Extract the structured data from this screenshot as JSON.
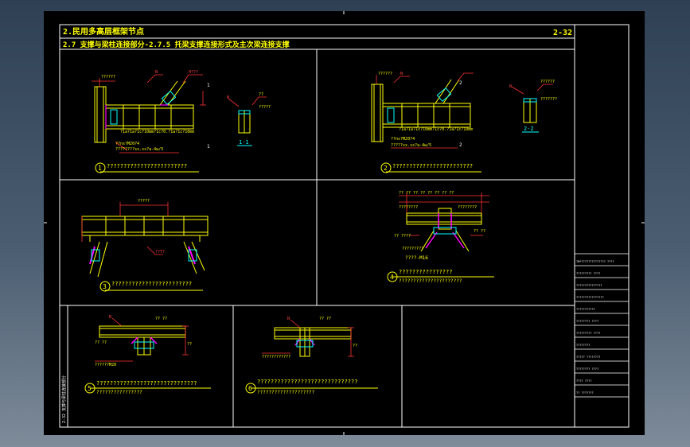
{
  "drawing": {
    "header_title": "2.民用多高层框架节点",
    "sub_title": "2.7 支撑与梁柱连接部分-2.7.5 托梁支撑连接形式及主次梁连接支撑",
    "page_number": "2-32",
    "side_label": "2-32 支撑与梁柱连接部分"
  },
  "details": [
    {
      "number": "1",
      "caption": "????????????????????????"
    },
    {
      "number": "2",
      "caption": "????????????????????????"
    },
    {
      "number": "3",
      "caption": "????????????????????????"
    },
    {
      "number": "4",
      "caption": "????????????????",
      "caption2": "??????????????????????"
    },
    {
      "number": "5",
      "caption": "??????????????????????????????",
      "caption2": "????????????????"
    },
    {
      "number": "6",
      "caption": "??????????????????????????????",
      "caption2": "????????????????????"
    }
  ],
  "section_labels": {
    "s11": "1-1",
    "s22": "2-2"
  },
  "annotations": {
    "d1_weld": "?1a?1a?1c?10mm?1c?0.?1a?1c?10mm",
    "d1_bolt": "??ns?M20?4",
    "d1_bolt2": "????????sx.ss?a-4w/5",
    "d2_weld": "?1a?1a?1c?10mm?1c?0.?1a?1c?10mm",
    "d2_bolt": "??ns?M20?4",
    "d2_bolt2": "?????sx.ss?a-4w/5",
    "d3_label": "??T?",
    "d4_label": "????-M16",
    "d5_label": "??????M20",
    "d6_label": "????????????"
  },
  "title_block": [
    "?RF?????????????? ????",
    "????????? ????",
    "???????????????",
    "????????????????",
    "???????????",
    "???????? ????",
    "????????? ????",
    "????????",
    "????? ????????",
    "???????? ????",
    "???? ????",
    "?? ???????"
  ],
  "colors": {
    "sheet": "#000000",
    "frame": "#ffffff",
    "title_text": "#ffff00",
    "steel": "#ffff00",
    "dimension": "#ff3333",
    "weld": "#ff00ff",
    "plate": "#00ffff",
    "text_red": "#ff4040"
  }
}
